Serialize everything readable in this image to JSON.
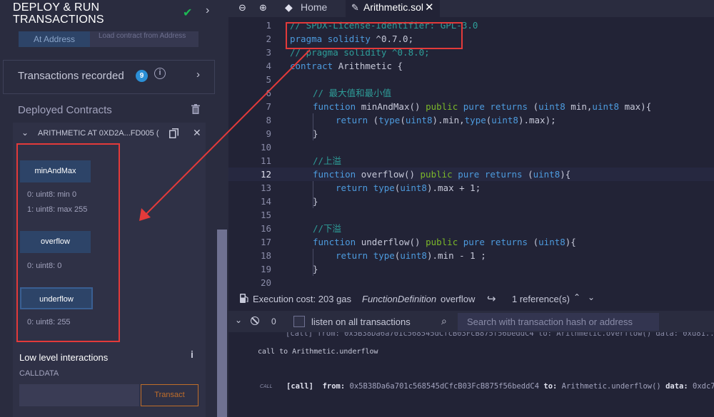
{
  "left_panel": {
    "title": "DEPLOY & RUN TRANSACTIONS",
    "at_address": "At Address",
    "load_address": "Load contract from Address",
    "transactions_label": "Transactions recorded",
    "transactions_count": "9",
    "deployed_label": "Deployed Contracts",
    "contract_name": "ARITHMETIC AT 0XD2A...FD005 (",
    "functions": [
      {
        "label": "minAndMax",
        "outputs": [
          "0: uint8: min 0",
          "1: uint8: max 255"
        ]
      },
      {
        "label": "overflow",
        "outputs": [
          "0: uint8: 0"
        ]
      },
      {
        "label": "underflow",
        "outputs": [
          "0: uint8: 255"
        ]
      }
    ],
    "low_level_title": "Low level interactions",
    "calldata_label": "CALLDATA",
    "transact_label": "Transact"
  },
  "tabs": [
    {
      "label": "Home"
    },
    {
      "label": "Arithmetic.sol"
    }
  ],
  "editor": {
    "current_line": 12,
    "lines": [
      {
        "n": "1",
        "text": "// SPDX-License-Identifier: GPL-3.0"
      },
      {
        "n": "2",
        "text": "pragma solidity ^0.7.0;"
      },
      {
        "n": "3",
        "text": "// pragma solidity ^0.8.0;"
      },
      {
        "n": "4",
        "text": "contract Arithmetic {"
      },
      {
        "n": "5",
        "text": ""
      },
      {
        "n": "6",
        "text": "// 最大值和最小值"
      },
      {
        "n": "7",
        "text": "function minAndMax() public pure returns (uint8 min,uint8 max){"
      },
      {
        "n": "8",
        "text": "return (type(uint8).min,type(uint8).max);"
      },
      {
        "n": "9",
        "text": "}"
      },
      {
        "n": "10",
        "text": ""
      },
      {
        "n": "11",
        "text": "//上溢"
      },
      {
        "n": "12",
        "text": "function overflow() public pure returns (uint8){"
      },
      {
        "n": "13",
        "text": "return type(uint8).max + 1;"
      },
      {
        "n": "14",
        "text": "}"
      },
      {
        "n": "15",
        "text": ""
      },
      {
        "n": "16",
        "text": "//下溢"
      },
      {
        "n": "17",
        "text": "function underflow() public pure returns (uint8){"
      },
      {
        "n": "18",
        "text": "return type(uint8).min - 1 ;"
      },
      {
        "n": "19",
        "text": "}"
      },
      {
        "n": "20",
        "text": ""
      }
    ]
  },
  "status": {
    "exec_cost": "Execution cost: 203 gas",
    "fn_def": "FunctionDefinition",
    "fn_def_name": "overflow",
    "refs": "1 reference(s)"
  },
  "terminal": {
    "count": "0",
    "listen_label": "listen on all transactions",
    "search_placeholder": "Search with transaction hash or address",
    "line1": "[call]  from: 0x5B38Da6a701c568545dCfcB03FcB875f56beddC4 to: Arithmetic.overflow() data: 0xd81...",
    "call_msg": "call to Arithmetic.underflow",
    "call_tag": "CALL",
    "call_kw": "[call]",
    "from_kw": "from:",
    "from_val": "0x5B38Da6a701c568545dCfcB03FcB875f56beddC4",
    "to_kw": "to:",
    "to_val": "Arithmetic.underflow()",
    "data_kw": "data:",
    "data_val": "0xdc7..."
  },
  "colors": {
    "accent": "#2d4468",
    "highlight_red": "#e33a3a",
    "transact": "#c06e2a",
    "comment": "#2e9e99",
    "keyword": "#4d9bde"
  }
}
